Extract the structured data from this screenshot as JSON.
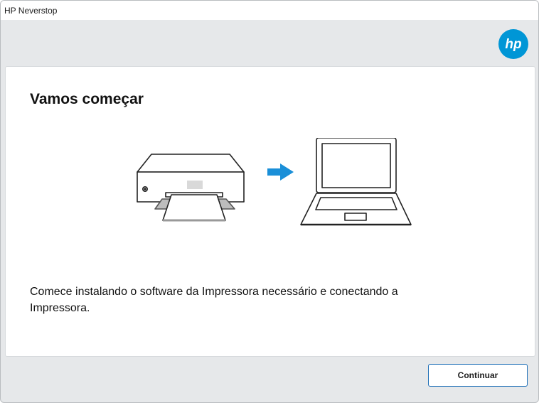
{
  "window": {
    "title": "HP Neverstop"
  },
  "header": {
    "logo_icon": "hp-logo-icon",
    "logo_text": "hp",
    "brand_color": "#0096d6"
  },
  "main": {
    "heading": "Vamos começar",
    "description": "Comece instalando o software da Impressora necessário e conectando a Impressora.",
    "illustration": {
      "icons": [
        "printer-icon",
        "arrow-right-icon",
        "laptop-icon"
      ],
      "arrow_color": "#1a8fd8"
    }
  },
  "footer": {
    "continue_label": "Continuar",
    "button_border_color": "#1f6fb7"
  }
}
